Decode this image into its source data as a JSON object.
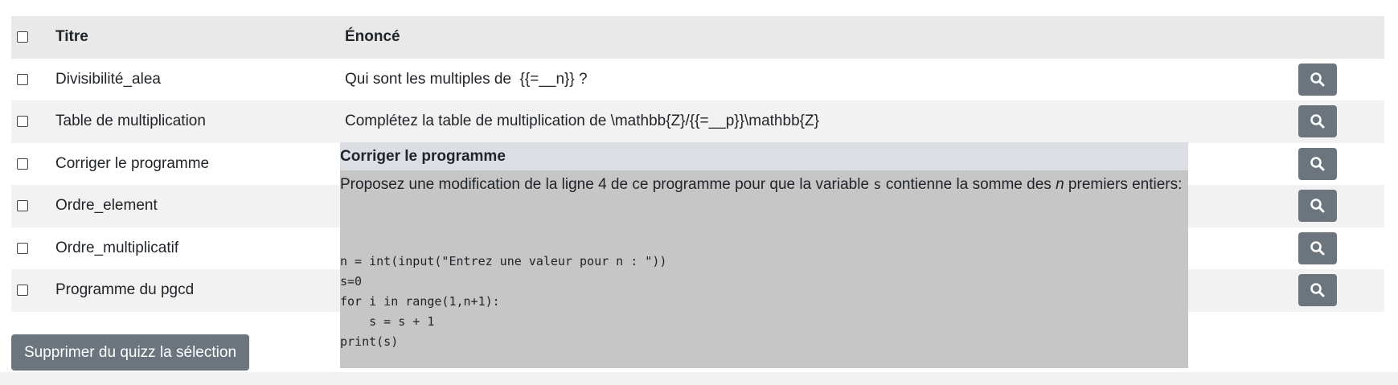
{
  "table": {
    "headers": {
      "title": "Titre",
      "enonce": "Énoncé"
    },
    "rows": [
      {
        "title": "Divisibilité_alea",
        "enonce": "Qui sont les multiples de  {{=__n}} ?"
      },
      {
        "title": "Table de multiplication",
        "enonce": "Complétez la table de multiplication de \\mathbb{Z}/{{=__p}}\\mathbb{Z}"
      },
      {
        "title": "Corriger le programme",
        "enonce": ""
      },
      {
        "title": "Ordre_element",
        "enonce": ""
      },
      {
        "title": "Ordre_multiplicatif",
        "enonce": ""
      },
      {
        "title": "Programme du pgcd",
        "enonce": ""
      }
    ]
  },
  "actions": {
    "delete_label": "Supprimer du quizz la sélection"
  },
  "icons": {
    "search": "search-icon",
    "checkbox": "checkbox"
  },
  "popup": {
    "title": "Corriger le programme",
    "text_before": "Proposez une modification de la ligne 4 de ce programme pour que la variable ",
    "var": "s",
    "text_mid": " contienne la somme des ",
    "ital": "n",
    "text_after": " premiers entiers:",
    "code_lines": [
      "n = int(input(\"Entrez une valeur pour n : \"))",
      "s=0",
      "for i in range(1,n+1):",
      "    s = s + 1",
      "print(s)"
    ]
  },
  "colors": {
    "button": "#6c757d",
    "popup_bg": "#c6c6c6",
    "popup_header": "#dbdfe4",
    "stripe": "#f2f2f2"
  }
}
